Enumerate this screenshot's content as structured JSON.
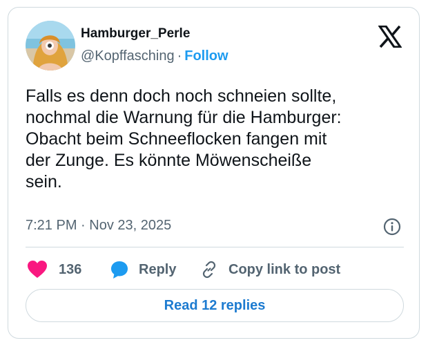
{
  "author": {
    "display_name": "Hamburger_Perle",
    "handle": "@Kopffasching",
    "separator": "·",
    "follow_label": "Follow",
    "avatar": "profile-photo"
  },
  "brand": {
    "logo": "x-logo",
    "color": "#0f1419"
  },
  "tweet": {
    "text": "Falls es denn doch noch schneien sollte,\nnochmal die Warnung für die Hamburger:\nObacht beim Schneeflocken fangen mit\nder Zunge. Es könnte Möwenscheiße\nsein.",
    "timestamp": "7:21 PM · Nov 23, 2025"
  },
  "actions": {
    "like_count": "136",
    "reply_label": "Reply",
    "copy_label": "Copy link to post",
    "read_replies_label": "Read 12 replies"
  },
  "colors": {
    "accent": "#1d9bf0",
    "like": "#f91880",
    "reply_icon": "#1d9bf0",
    "muted": "#536471",
    "border": "#cfd9de"
  }
}
